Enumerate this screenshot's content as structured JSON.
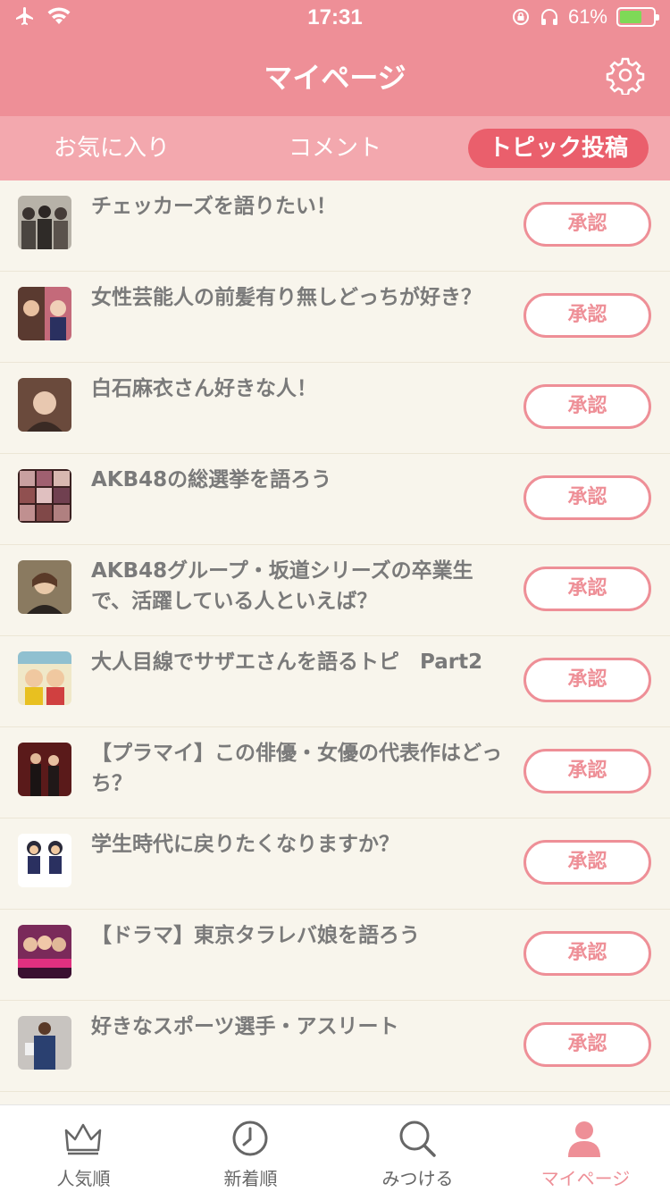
{
  "status": {
    "time": "17:31",
    "battery": "61%",
    "battery_level": 0.61
  },
  "header": {
    "title": "マイページ",
    "settings_icon": "gear-icon"
  },
  "tabs": [
    {
      "label": "お気に入り",
      "active": false
    },
    {
      "label": "コメント",
      "active": false
    },
    {
      "label": "トピック投稿",
      "active": true
    }
  ],
  "colors": {
    "accent": "#ee8f97",
    "accent_dark": "#ea5f6c",
    "tab_bg": "#f3a8ae",
    "list_bg": "#f8f5ec",
    "text": "#7a7a7a"
  },
  "approve_label": "承認",
  "topics": [
    {
      "title": "チェッカーズを語りたい！",
      "approve": "承認"
    },
    {
      "title": "女性芸能人の前髪有り無しどっちが好き？",
      "approve": "承認"
    },
    {
      "title": "白石麻衣さん好きな人！",
      "approve": "承認"
    },
    {
      "title": "AKB48の総選挙を語ろう",
      "approve": "承認"
    },
    {
      "title": "AKB48グループ・坂道シリーズの卒業生で、活躍している人といえば？",
      "approve": "承認"
    },
    {
      "title": "大人目線でサザエさんを語るトピ　Part2",
      "approve": "承認"
    },
    {
      "title": "【プラマイ】この俳優・女優の代表作はどっち？",
      "approve": "承認"
    },
    {
      "title": "学生時代に戻りたくなりますか？",
      "approve": "承認"
    },
    {
      "title": "【ドラマ】東京タラレバ娘を語ろう",
      "approve": "承認"
    },
    {
      "title": "好きなスポーツ選手・アスリート",
      "approve": "承認"
    }
  ],
  "tabbar": [
    {
      "label": "人気順",
      "icon": "crown-icon",
      "active": false
    },
    {
      "label": "新着順",
      "icon": "clock-icon",
      "active": false
    },
    {
      "label": "みつける",
      "icon": "search-icon",
      "active": false
    },
    {
      "label": "マイページ",
      "icon": "person-icon",
      "active": true
    }
  ]
}
